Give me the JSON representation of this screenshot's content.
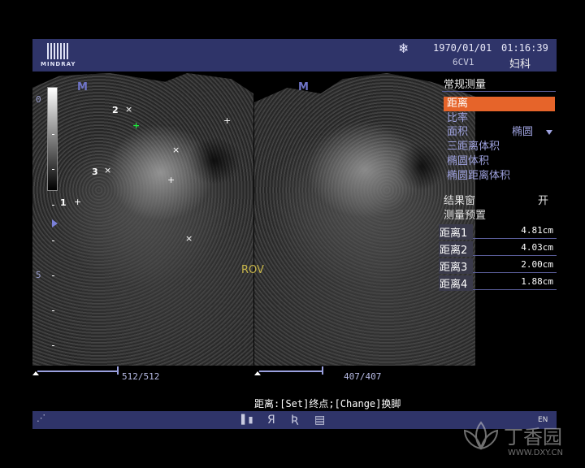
{
  "header": {
    "logo_text": "MINDRAY",
    "freeze_icon": "snowflake-icon",
    "date": "1970/01/01",
    "time": "01:16:39",
    "probe": "6CV1",
    "exam": "妇科"
  },
  "image": {
    "depth_top": "0",
    "depth_mid": "5",
    "label": "ROV",
    "calipers": [
      "1",
      "2",
      "3"
    ],
    "left_frames": "512/512",
    "right_frames": "407/407",
    "left_progress": 1.0,
    "right_progress": 1.0
  },
  "panel": {
    "title": "常规测量",
    "menu": [
      {
        "label": "距离",
        "active": true
      },
      {
        "label": "比率"
      },
      {
        "label": "面积",
        "sub": "椭圆"
      },
      {
        "label": "三距离体积"
      },
      {
        "label": "椭圆体积"
      },
      {
        "label": "椭圆距离体积"
      }
    ],
    "options": [
      {
        "label": "结果窗",
        "value": "开"
      },
      {
        "label": "测量预置",
        "value": ""
      }
    ],
    "results": [
      {
        "label": "距离1",
        "value": "4.81cm"
      },
      {
        "label": "距离2",
        "value": "4.03cm"
      },
      {
        "label": "距离3",
        "value": "2.00cm"
      },
      {
        "label": "距离4",
        "value": "1.88cm"
      }
    ]
  },
  "status": "距离:[Set]终点;[Change]换脚",
  "bottom": {
    "lang": "EN"
  },
  "watermark": {
    "text": "丁香园",
    "url": "WWW.DXY.CN"
  }
}
